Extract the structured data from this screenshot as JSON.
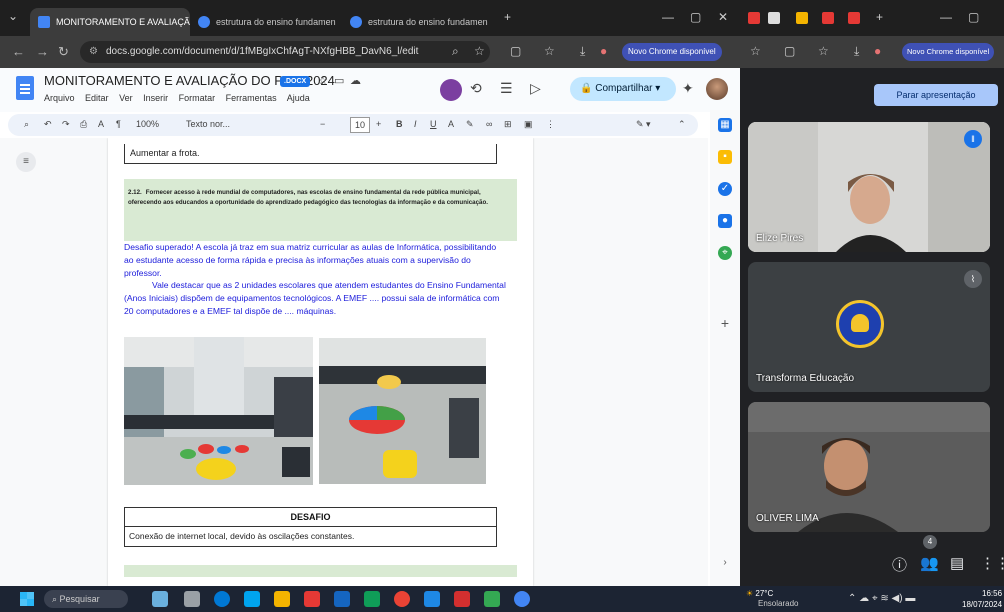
{
  "browser": {
    "tabs": [
      {
        "label": "MONITORAMENTO E AVALIAÇÃ",
        "active": true
      },
      {
        "label": "estrutura do ensino fundamen",
        "active": false
      },
      {
        "label": "estrutura do ensino fundamen",
        "active": false
      }
    ],
    "new_tab": "+",
    "url": "docs.google.com/document/d/1fMBgIxChfAgT-NXfgHBB_DavN6_l/edit",
    "update_label": "Novo Chrome disponível"
  },
  "docs": {
    "title": "MONITORAMENTO E AVALIAÇÃO DO PME 2024",
    "badge": ".DOCX",
    "menus": [
      "Arquivo",
      "Editar",
      "Ver",
      "Inserir",
      "Formatar",
      "Ferramentas",
      "Ajuda"
    ],
    "share_label": "Compartilhar",
    "toolbar": {
      "zoom": "100%",
      "style": "Texto nor...",
      "font_size": "10"
    },
    "table_top_cell": "Aumentar a frota.",
    "goal": {
      "number": "2.12.",
      "text": "Fornecer acesso à rede mundial de computadores, nas escolas de ensino fundamental da rede pública municipal, oferecendo aos educandos a oportunidade do aprendizado pedagógico das tecnologias da informação e da comunicação."
    },
    "challenge_para1": "Desafio superado! A escola já traz em sua matriz curricular as aulas de Informática, possibilitando ao estudante acesso de forma rápida e precisa às informações atuais com a supervisão do professor.",
    "challenge_para2": "Vale destacar que as 2 unidades escolares que atendem estudantes do Ensino Fundamental (Anos Iniciais) dispõem de equipamentos tecnológicos. A EMEF .... possui sala de informática com 20 computadores e a EMEF tal dispõe de .... máquinas.",
    "desafio_header": "DESAFIO",
    "desafio_cell": "Conexão de internet local, devido às oscilações constantes."
  },
  "meet": {
    "update_label": "Novo Chrome disponível",
    "stop_presenting": "Parar apresentação",
    "participants": [
      {
        "name": "Elize Pires"
      },
      {
        "name": "Transforma Educação"
      },
      {
        "name": "OLIVER LIMA"
      }
    ],
    "participant_count": "4"
  },
  "taskbar": {
    "search_placeholder": "Pesquisar",
    "temperature": "27°C",
    "weather_desc": "Ensolarado",
    "time": "16:56",
    "date": "18/07/2024"
  }
}
